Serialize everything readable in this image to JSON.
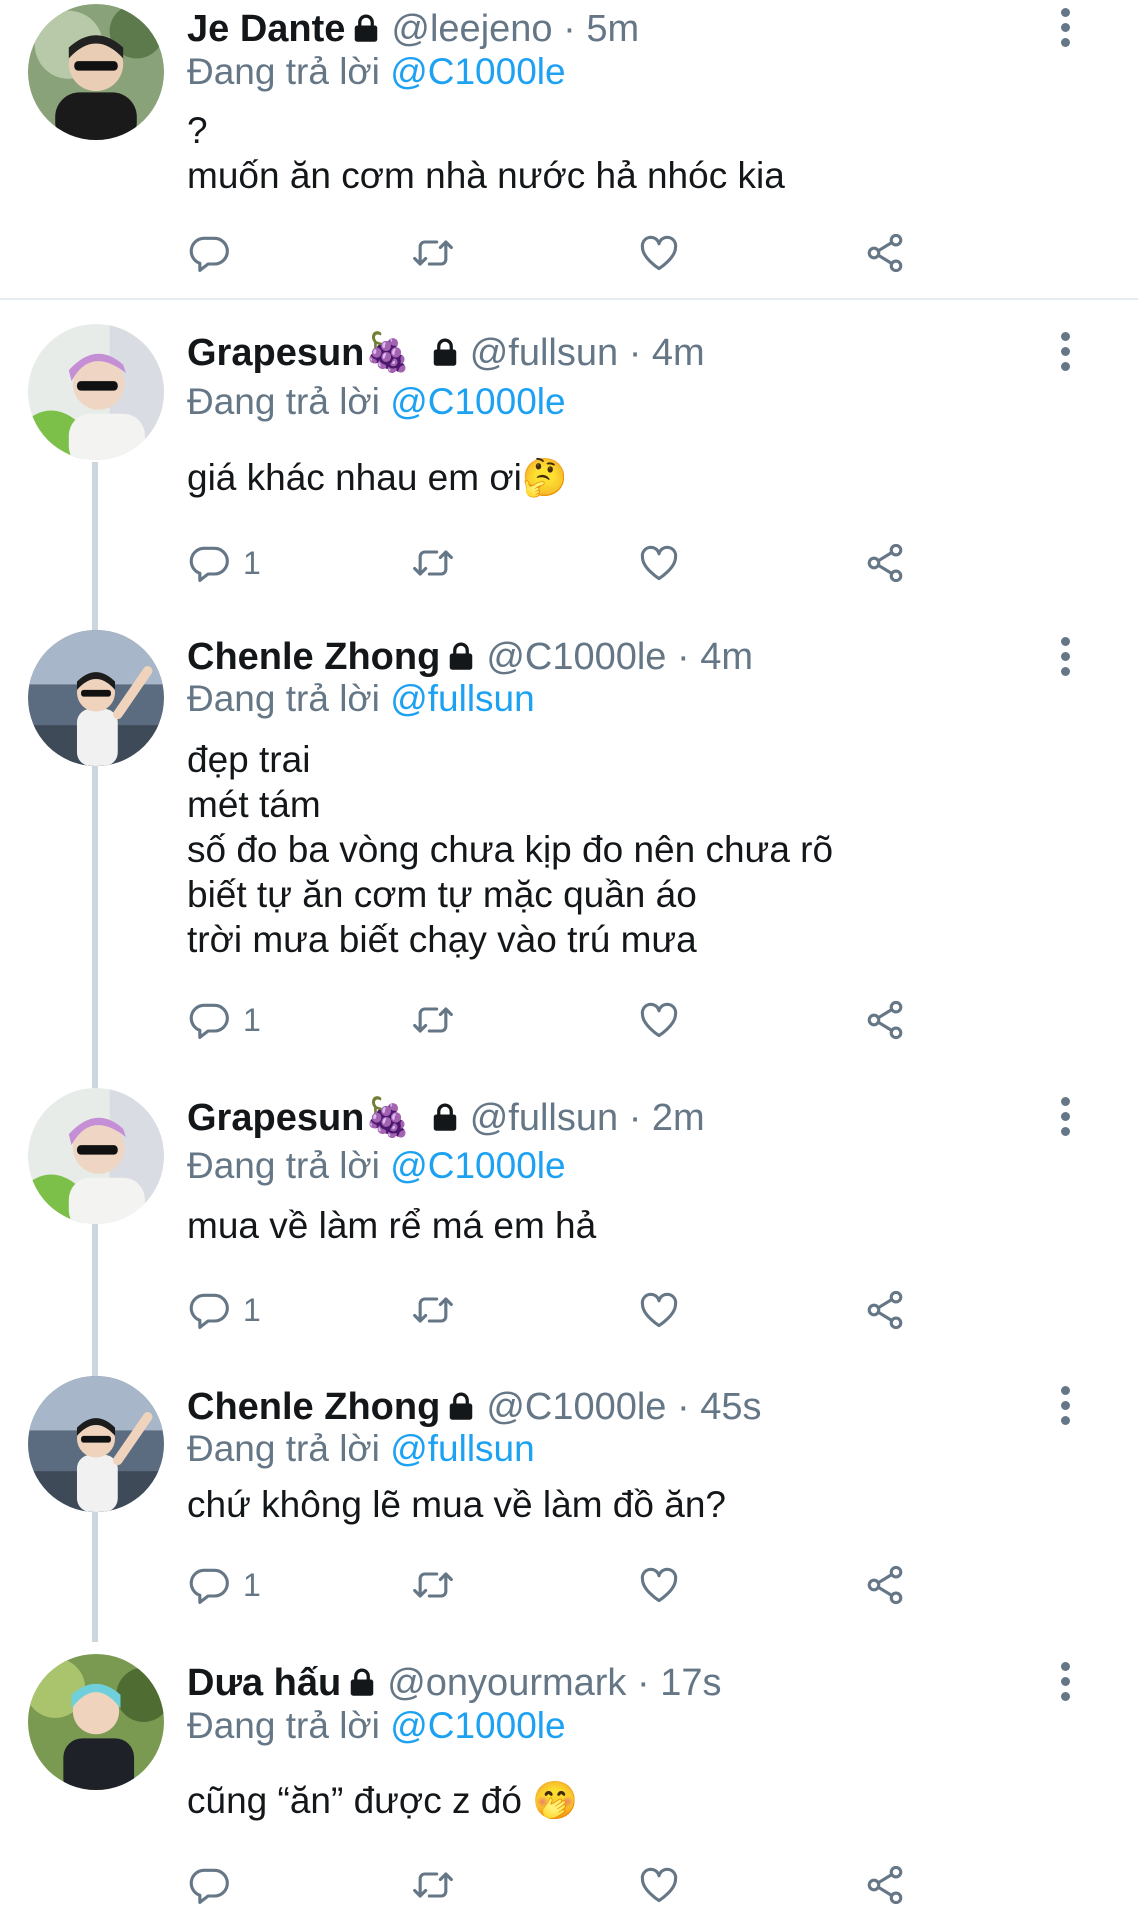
{
  "tweets": [
    {
      "name": "Je Dante",
      "handle": "@leejeno",
      "time": "· 5m",
      "reply_label": "Đang trả lời",
      "reply_to": "@C1000le",
      "text": "?\nmuốn ăn cơm nhà nước hả nhóc kia",
      "reply_count": ""
    },
    {
      "name": "Grapesun🍇",
      "handle": "@fullsun",
      "time": "· 4m",
      "reply_label": "Đang trả lời",
      "reply_to": "@C1000le",
      "text": "giá khác nhau em ơi🤔",
      "reply_count": "1"
    },
    {
      "name": "Chenle Zhong",
      "handle": "@C1000le",
      "time": "· 4m",
      "reply_label": "Đang trả lời",
      "reply_to": "@fullsun",
      "text": "đẹp trai\nmét tám\nsố đo ba vòng chưa kịp đo nên chưa rõ\nbiết tự ăn cơm tự mặc quần áo\ntrời mưa biết chạy vào trú mưa",
      "reply_count": "1"
    },
    {
      "name": "Grapesun🍇",
      "handle": "@fullsun",
      "time": "· 2m",
      "reply_label": "Đang trả lời",
      "reply_to": "@C1000le",
      "text": "mua về làm rể má em hả",
      "reply_count": "1"
    },
    {
      "name": "Chenle Zhong",
      "handle": "@C1000le",
      "time": "· 45s",
      "reply_label": "Đang trả lời",
      "reply_to": "@fullsun",
      "text": "chứ không lẽ mua về làm đồ ăn?",
      "reply_count": "1"
    },
    {
      "name": "Dưa hấu",
      "handle": "@onyourmark",
      "time": "· 17s",
      "reply_label": "Đang trả lời",
      "reply_to": "@C1000le",
      "text": "cũng “ăn” được z đó 🤭",
      "reply_count": ""
    }
  ],
  "icons": {
    "reply": "reply-icon",
    "retweet": "retweet-icon",
    "like": "heart-icon",
    "share": "share-icon",
    "lock": "lock-icon",
    "more": "more-options-icon"
  },
  "colors": {
    "mention": "#1da1f2",
    "meta": "#657786",
    "thread_line": "#ccd6dd"
  }
}
